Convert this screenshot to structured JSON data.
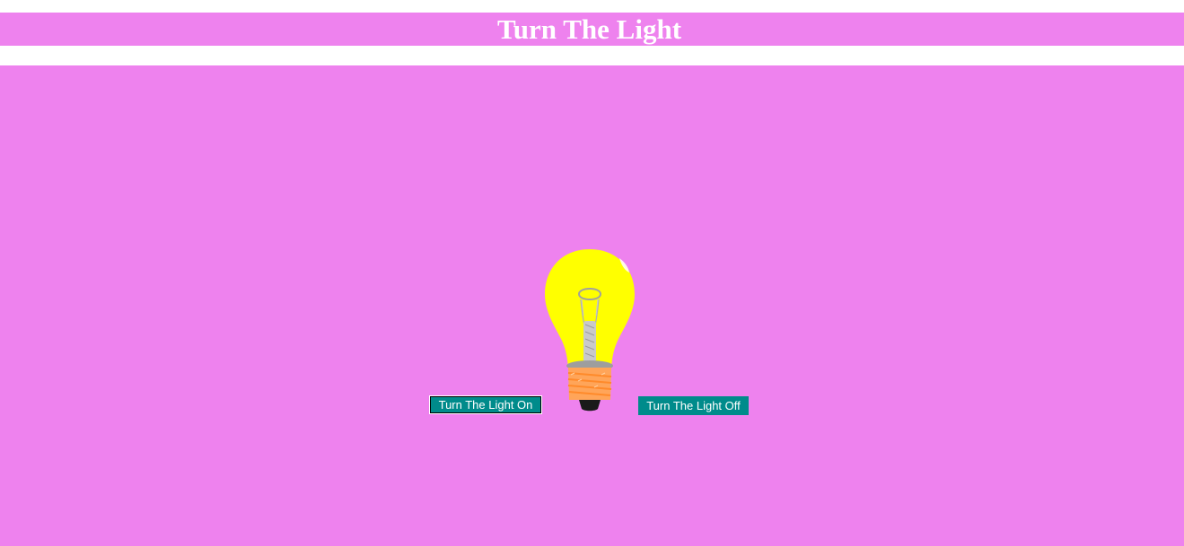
{
  "header": {
    "title": "Turn The Light"
  },
  "controls": {
    "on_label": "Turn The Light On",
    "off_label": "Turn The Light Off"
  },
  "bulb": {
    "state": "on",
    "icon": "lightbulb-icon"
  },
  "colors": {
    "background": "#ee82ee",
    "button": "#008b8b",
    "bulb_glass": "#ffff00",
    "bulb_base": "#ffa559"
  }
}
